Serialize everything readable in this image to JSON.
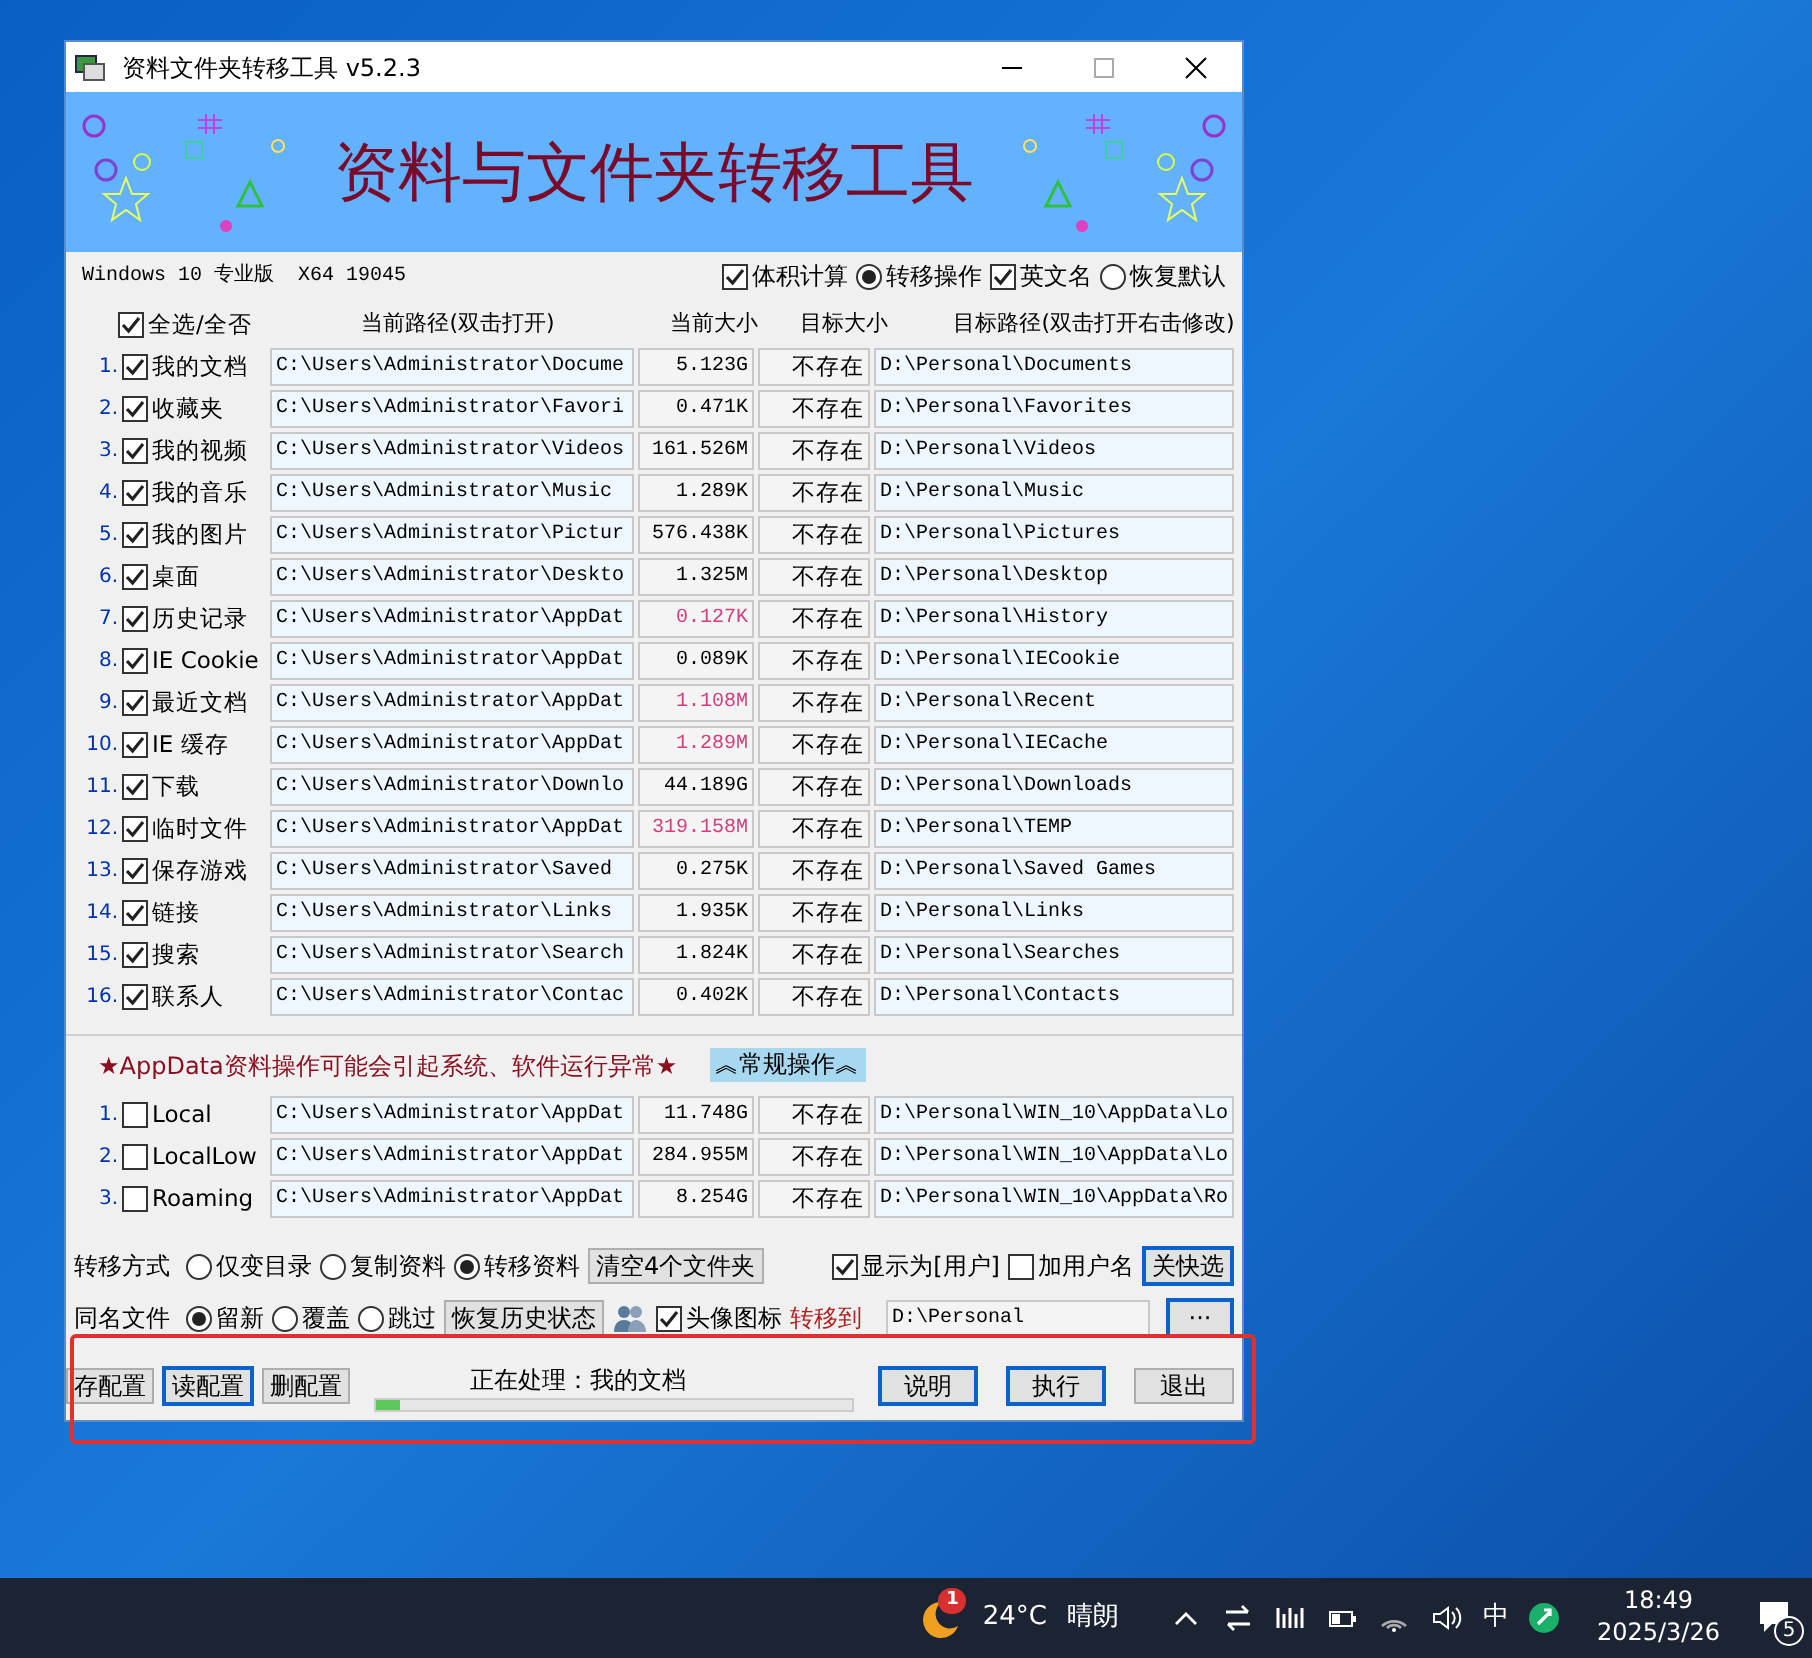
{
  "window": {
    "title": "资料文件夹转移工具 v5.2.3"
  },
  "banner": {
    "title": "资料与文件夹转移工具"
  },
  "system_info": "Windows 10 专业版  X64 19045",
  "options": [
    {
      "kind": "checkbox",
      "label": "体积计算",
      "checked": true
    },
    {
      "kind": "radio",
      "label": "转移操作",
      "selected": true
    },
    {
      "kind": "checkbox",
      "label": "英文名",
      "checked": true
    },
    {
      "kind": "radio",
      "label": "恢复默认",
      "selected": false
    }
  ],
  "table": {
    "select_all": {
      "label": "全选/全否",
      "checked": true
    },
    "columns": [
      "当前路径(双击打开)",
      "当前大小",
      "目标大小",
      "目标路径(双击打开右击修改)"
    ],
    "rows": [
      {
        "index": "1.",
        "name": "我的文档",
        "checked": true,
        "current_path": "C:\\Users\\Administrator\\Docume",
        "current_size": "5.123G",
        "size_warning": false,
        "target_size": "不存在",
        "target_path": "D:\\Personal\\Documents"
      },
      {
        "index": "2.",
        "name": "收藏夹",
        "checked": true,
        "current_path": "C:\\Users\\Administrator\\Favori",
        "current_size": "0.471K",
        "size_warning": false,
        "target_size": "不存在",
        "target_path": "D:\\Personal\\Favorites"
      },
      {
        "index": "3.",
        "name": "我的视频",
        "checked": true,
        "current_path": "C:\\Users\\Administrator\\Videos",
        "current_size": "161.526M",
        "size_warning": false,
        "target_size": "不存在",
        "target_path": "D:\\Personal\\Videos"
      },
      {
        "index": "4.",
        "name": "我的音乐",
        "checked": true,
        "current_path": "C:\\Users\\Administrator\\Music",
        "current_size": "1.289K",
        "size_warning": false,
        "target_size": "不存在",
        "target_path": "D:\\Personal\\Music"
      },
      {
        "index": "5.",
        "name": "我的图片",
        "checked": true,
        "current_path": "C:\\Users\\Administrator\\Pictur",
        "current_size": "576.438K",
        "size_warning": false,
        "target_size": "不存在",
        "target_path": "D:\\Personal\\Pictures"
      },
      {
        "index": "6.",
        "name": "桌面",
        "checked": true,
        "current_path": "C:\\Users\\Administrator\\Deskto",
        "current_size": "1.325M",
        "size_warning": false,
        "target_size": "不存在",
        "target_path": "D:\\Personal\\Desktop"
      },
      {
        "index": "7.",
        "name": "历史记录",
        "checked": true,
        "current_path": "C:\\Users\\Administrator\\AppDat",
        "current_size": "0.127K",
        "size_warning": true,
        "target_size": "不存在",
        "target_path": "D:\\Personal\\History"
      },
      {
        "index": "8.",
        "name": "IE Cookie",
        "checked": true,
        "current_path": "C:\\Users\\Administrator\\AppDat",
        "current_size": "0.089K",
        "size_warning": false,
        "target_size": "不存在",
        "target_path": "D:\\Personal\\IECookie"
      },
      {
        "index": "9.",
        "name": "最近文档",
        "checked": true,
        "current_path": "C:\\Users\\Administrator\\AppDat",
        "current_size": "1.108M",
        "size_warning": true,
        "target_size": "不存在",
        "target_path": "D:\\Personal\\Recent"
      },
      {
        "index": "10.",
        "name": "IE 缓存",
        "checked": true,
        "current_path": "C:\\Users\\Administrator\\AppDat",
        "current_size": "1.289M",
        "size_warning": true,
        "target_size": "不存在",
        "target_path": "D:\\Personal\\IECache"
      },
      {
        "index": "11.",
        "name": "下载",
        "checked": true,
        "current_path": "C:\\Users\\Administrator\\Downlo",
        "current_size": "44.189G",
        "size_warning": false,
        "target_size": "不存在",
        "target_path": "D:\\Personal\\Downloads"
      },
      {
        "index": "12.",
        "name": "临时文件",
        "checked": true,
        "current_path": "C:\\Users\\Administrator\\AppDat",
        "current_size": "319.158M",
        "size_warning": true,
        "target_size": "不存在",
        "target_path": "D:\\Personal\\TEMP"
      },
      {
        "index": "13.",
        "name": "保存游戏",
        "checked": true,
        "current_path": "C:\\Users\\Administrator\\Saved",
        "current_size": "0.275K",
        "size_warning": false,
        "target_size": "不存在",
        "target_path": "D:\\Personal\\Saved Games"
      },
      {
        "index": "14.",
        "name": "链接",
        "checked": true,
        "current_path": "C:\\Users\\Administrator\\Links",
        "current_size": "1.935K",
        "size_warning": false,
        "target_size": "不存在",
        "target_path": "D:\\Personal\\Links"
      },
      {
        "index": "15.",
        "name": "搜索",
        "checked": true,
        "current_path": "C:\\Users\\Administrator\\Search",
        "current_size": "1.824K",
        "size_warning": false,
        "target_size": "不存在",
        "target_path": "D:\\Personal\\Searches"
      },
      {
        "index": "16.",
        "name": "联系人",
        "checked": true,
        "current_path": "C:\\Users\\Administrator\\Contac",
        "current_size": "0.402K",
        "size_warning": false,
        "target_size": "不存在",
        "target_path": "D:\\Personal\\Contacts"
      }
    ]
  },
  "warning": "★AppData资料操作可能会引起系统、软件运行异常★",
  "toggle_button": "︽常规操作︽",
  "appdata_rows": [
    {
      "index": "1.",
      "name": "Local",
      "checked": false,
      "current_path": "C:\\Users\\Administrator\\AppDat",
      "current_size": "11.748G",
      "size_warning": false,
      "target_size": "不存在",
      "target_path": "D:\\Personal\\WIN_10\\AppData\\Lo"
    },
    {
      "index": "2.",
      "name": "LocalLow",
      "checked": false,
      "current_path": "C:\\Users\\Administrator\\AppDat",
      "current_size": "284.955M",
      "size_warning": false,
      "target_size": "不存在",
      "target_path": "D:\\Personal\\WIN_10\\AppData\\Lo"
    },
    {
      "index": "3.",
      "name": "Roaming",
      "checked": false,
      "current_path": "C:\\Users\\Administrator\\AppDat",
      "current_size": "8.254G",
      "size_warning": false,
      "target_size": "不存在",
      "target_path": "D:\\Personal\\WIN_10\\AppData\\Ro"
    }
  ],
  "transfer_mode": {
    "label": "转移方式",
    "choices": [
      {
        "label": "仅变目录",
        "selected": false
      },
      {
        "label": "复制资料",
        "selected": false
      },
      {
        "label": "转移资料",
        "selected": true
      }
    ],
    "clear_button": "清空4个文件夹",
    "show_as_user": {
      "label": "显示为[用户]",
      "checked": true
    },
    "add_username": {
      "label": "加用户名",
      "checked": false
    },
    "quick_select_button": "关快选"
  },
  "same_name": {
    "label": "同名文件",
    "choices": [
      {
        "label": "留新",
        "selected": true
      },
      {
        "label": "覆盖",
        "selected": false
      },
      {
        "label": "跳过",
        "selected": false
      }
    ],
    "restore_button": "恢复历史状态",
    "avatar_icon": {
      "label": "头像图标",
      "checked": true
    },
    "target_label": "转移到",
    "target_path": "D:\\Personal",
    "browse_button": "···"
  },
  "footer": {
    "config_buttons": [
      {
        "label": "存配置",
        "selected": false
      },
      {
        "label": "读配置",
        "selected": true
      },
      {
        "label": "删配置",
        "selected": false
      }
    ],
    "status": "正在处理：我的文档",
    "progress": {
      "level": 0.05
    },
    "buttons": [
      {
        "label": "说明",
        "highlighted": true
      },
      {
        "label": "执行",
        "highlighted": true
      },
      {
        "label": "退出",
        "highlighted": false
      }
    ]
  },
  "taskbar": {
    "weather": {
      "badge": "1",
      "temperature": "24°C",
      "condition": "晴朗"
    },
    "ime": "中",
    "time": "18:49",
    "date": "2025/3/26",
    "notifications": "5"
  }
}
